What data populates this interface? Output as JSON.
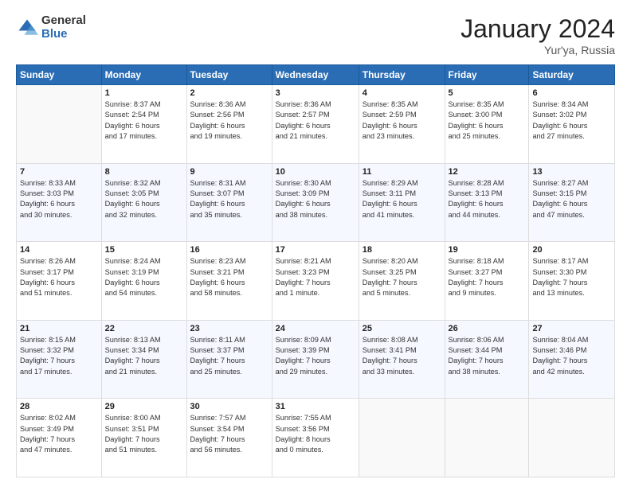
{
  "logo": {
    "general": "General",
    "blue": "Blue"
  },
  "header": {
    "title": "January 2024",
    "subtitle": "Yur'ya, Russia"
  },
  "columns": [
    "Sunday",
    "Monday",
    "Tuesday",
    "Wednesday",
    "Thursday",
    "Friday",
    "Saturday"
  ],
  "weeks": [
    [
      {
        "num": "",
        "info": ""
      },
      {
        "num": "1",
        "info": "Sunrise: 8:37 AM\nSunset: 2:54 PM\nDaylight: 6 hours\nand 17 minutes."
      },
      {
        "num": "2",
        "info": "Sunrise: 8:36 AM\nSunset: 2:56 PM\nDaylight: 6 hours\nand 19 minutes."
      },
      {
        "num": "3",
        "info": "Sunrise: 8:36 AM\nSunset: 2:57 PM\nDaylight: 6 hours\nand 21 minutes."
      },
      {
        "num": "4",
        "info": "Sunrise: 8:35 AM\nSunset: 2:59 PM\nDaylight: 6 hours\nand 23 minutes."
      },
      {
        "num": "5",
        "info": "Sunrise: 8:35 AM\nSunset: 3:00 PM\nDaylight: 6 hours\nand 25 minutes."
      },
      {
        "num": "6",
        "info": "Sunrise: 8:34 AM\nSunset: 3:02 PM\nDaylight: 6 hours\nand 27 minutes."
      }
    ],
    [
      {
        "num": "7",
        "info": "Sunrise: 8:33 AM\nSunset: 3:03 PM\nDaylight: 6 hours\nand 30 minutes."
      },
      {
        "num": "8",
        "info": "Sunrise: 8:32 AM\nSunset: 3:05 PM\nDaylight: 6 hours\nand 32 minutes."
      },
      {
        "num": "9",
        "info": "Sunrise: 8:31 AM\nSunset: 3:07 PM\nDaylight: 6 hours\nand 35 minutes."
      },
      {
        "num": "10",
        "info": "Sunrise: 8:30 AM\nSunset: 3:09 PM\nDaylight: 6 hours\nand 38 minutes."
      },
      {
        "num": "11",
        "info": "Sunrise: 8:29 AM\nSunset: 3:11 PM\nDaylight: 6 hours\nand 41 minutes."
      },
      {
        "num": "12",
        "info": "Sunrise: 8:28 AM\nSunset: 3:13 PM\nDaylight: 6 hours\nand 44 minutes."
      },
      {
        "num": "13",
        "info": "Sunrise: 8:27 AM\nSunset: 3:15 PM\nDaylight: 6 hours\nand 47 minutes."
      }
    ],
    [
      {
        "num": "14",
        "info": "Sunrise: 8:26 AM\nSunset: 3:17 PM\nDaylight: 6 hours\nand 51 minutes."
      },
      {
        "num": "15",
        "info": "Sunrise: 8:24 AM\nSunset: 3:19 PM\nDaylight: 6 hours\nand 54 minutes."
      },
      {
        "num": "16",
        "info": "Sunrise: 8:23 AM\nSunset: 3:21 PM\nDaylight: 6 hours\nand 58 minutes."
      },
      {
        "num": "17",
        "info": "Sunrise: 8:21 AM\nSunset: 3:23 PM\nDaylight: 7 hours\nand 1 minute."
      },
      {
        "num": "18",
        "info": "Sunrise: 8:20 AM\nSunset: 3:25 PM\nDaylight: 7 hours\nand 5 minutes."
      },
      {
        "num": "19",
        "info": "Sunrise: 8:18 AM\nSunset: 3:27 PM\nDaylight: 7 hours\nand 9 minutes."
      },
      {
        "num": "20",
        "info": "Sunrise: 8:17 AM\nSunset: 3:30 PM\nDaylight: 7 hours\nand 13 minutes."
      }
    ],
    [
      {
        "num": "21",
        "info": "Sunrise: 8:15 AM\nSunset: 3:32 PM\nDaylight: 7 hours\nand 17 minutes."
      },
      {
        "num": "22",
        "info": "Sunrise: 8:13 AM\nSunset: 3:34 PM\nDaylight: 7 hours\nand 21 minutes."
      },
      {
        "num": "23",
        "info": "Sunrise: 8:11 AM\nSunset: 3:37 PM\nDaylight: 7 hours\nand 25 minutes."
      },
      {
        "num": "24",
        "info": "Sunrise: 8:09 AM\nSunset: 3:39 PM\nDaylight: 7 hours\nand 29 minutes."
      },
      {
        "num": "25",
        "info": "Sunrise: 8:08 AM\nSunset: 3:41 PM\nDaylight: 7 hours\nand 33 minutes."
      },
      {
        "num": "26",
        "info": "Sunrise: 8:06 AM\nSunset: 3:44 PM\nDaylight: 7 hours\nand 38 minutes."
      },
      {
        "num": "27",
        "info": "Sunrise: 8:04 AM\nSunset: 3:46 PM\nDaylight: 7 hours\nand 42 minutes."
      }
    ],
    [
      {
        "num": "28",
        "info": "Sunrise: 8:02 AM\nSunset: 3:49 PM\nDaylight: 7 hours\nand 47 minutes."
      },
      {
        "num": "29",
        "info": "Sunrise: 8:00 AM\nSunset: 3:51 PM\nDaylight: 7 hours\nand 51 minutes."
      },
      {
        "num": "30",
        "info": "Sunrise: 7:57 AM\nSunset: 3:54 PM\nDaylight: 7 hours\nand 56 minutes."
      },
      {
        "num": "31",
        "info": "Sunrise: 7:55 AM\nSunset: 3:56 PM\nDaylight: 8 hours\nand 0 minutes."
      },
      {
        "num": "",
        "info": ""
      },
      {
        "num": "",
        "info": ""
      },
      {
        "num": "",
        "info": ""
      }
    ]
  ]
}
